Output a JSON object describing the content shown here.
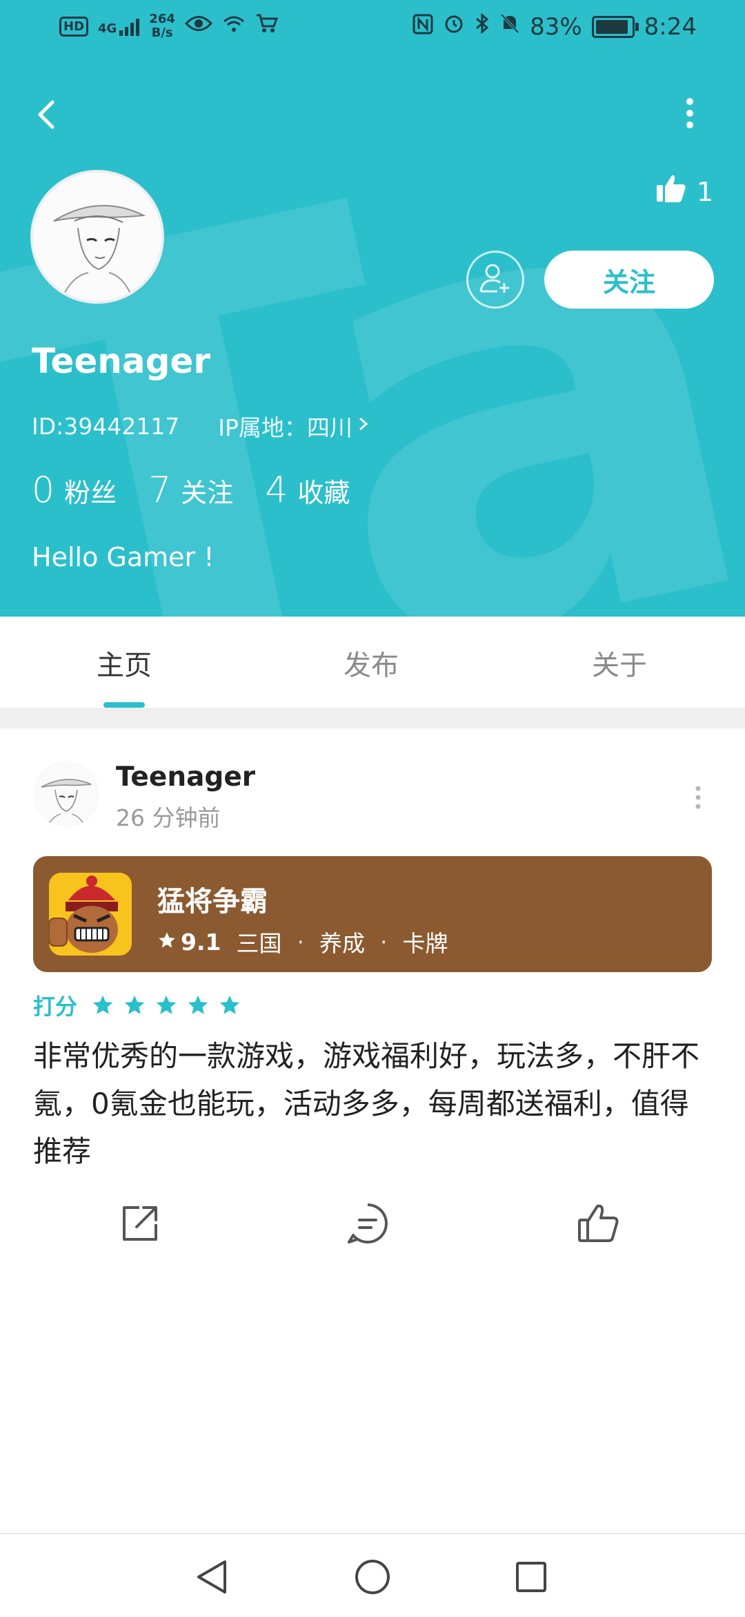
{
  "status_bar": {
    "left_badge": "HD",
    "network": "4G",
    "speed_value": "264",
    "speed_unit": "B/s",
    "battery": "83%",
    "time": "8:24"
  },
  "profile": {
    "username": "Teenager",
    "id_text": "ID:39442117",
    "ip_text": "IP属地：四川",
    "like_count": "1",
    "follow_label": "关注",
    "bio": "Hello Gamer !",
    "stats": [
      {
        "value": "0",
        "label": "粉丝"
      },
      {
        "value": "7",
        "label": "关注"
      },
      {
        "value": "4",
        "label": "收藏"
      }
    ],
    "accent_color": "#2bbfcc"
  },
  "tabs": [
    {
      "label": "主页",
      "active": true
    },
    {
      "label": "发布",
      "active": false
    },
    {
      "label": "关于",
      "active": false
    }
  ],
  "post": {
    "author": "Teenager",
    "time": "26 分钟前",
    "game": {
      "name": "猛将争霸",
      "rating": "9.1",
      "tags": [
        "三国",
        "养成",
        "卡牌"
      ],
      "card_color": "#8b5a30"
    },
    "score_label": "打分",
    "stars": 5,
    "text": "非常优秀的一款游戏，游戏福利好，玩法多，不肝不氪，0氪金也能玩，活动多多，每周都送福利，值得推荐",
    "actions": [
      "share-icon",
      "comment-icon",
      "like-icon"
    ]
  },
  "navbar": [
    "back-triangle-icon",
    "home-circle-icon",
    "recents-square-icon"
  ]
}
